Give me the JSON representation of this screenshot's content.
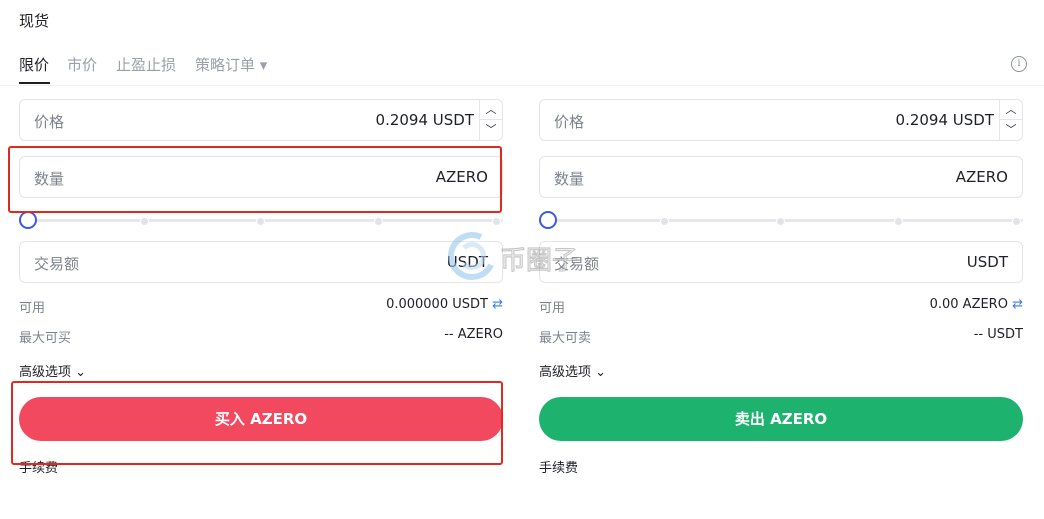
{
  "title": "现货",
  "tabs": [
    {
      "label": "限价",
      "active": true
    },
    {
      "label": "市价",
      "active": false
    },
    {
      "label": "止盈止损",
      "active": false
    },
    {
      "label": "策略订单 ▾",
      "active": false
    }
  ],
  "info_icon": "info-circle-icon",
  "buy": {
    "price": {
      "label": "价格",
      "value": "0.2094 USDT"
    },
    "quantity": {
      "label": "数量",
      "unit": "AZERO"
    },
    "amount": {
      "label": "交易额",
      "unit": "USDT"
    },
    "slider_level": 0,
    "available": {
      "label": "可用",
      "value": "0.000000 USDT"
    },
    "max": {
      "label": "最大可买",
      "value": "-- AZERO"
    },
    "advanced": "高级选项",
    "button": "买入 AZERO",
    "fee": "手续费"
  },
  "sell": {
    "price": {
      "label": "价格",
      "value": "0.2094 USDT"
    },
    "quantity": {
      "label": "数量",
      "unit": "AZERO"
    },
    "amount": {
      "label": "交易额",
      "unit": "USDT"
    },
    "slider_level": 0,
    "available": {
      "label": "可用",
      "value": "0.00 AZERO"
    },
    "max": {
      "label": "最大可卖",
      "value": "-- USDT"
    },
    "advanced": "高级选项",
    "button": "卖出 AZERO",
    "fee": "手续费"
  },
  "icons": {
    "stepper_up": "▲",
    "stepper_down": "▼",
    "swap": "⇄",
    "chevron": "⌄"
  },
  "watermark": "币圈子",
  "colors": {
    "buy": "#f2495e",
    "sell": "#1db36f",
    "slider": "#3b5bdb",
    "annotation": "#e02a20"
  }
}
